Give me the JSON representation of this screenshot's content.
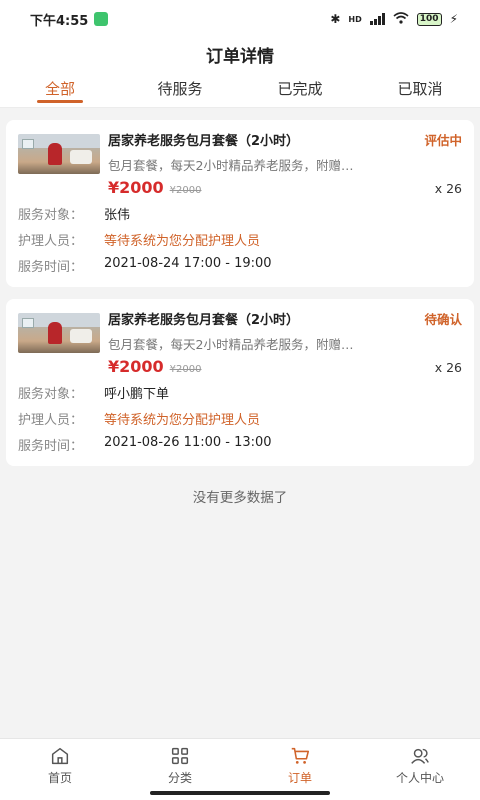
{
  "status_bar": {
    "time": "下午4:55",
    "network": "HD",
    "battery": "100"
  },
  "title": "订单详情",
  "tabs": [
    {
      "label": "全部",
      "active": true
    },
    {
      "label": "待服务",
      "active": false
    },
    {
      "label": "已完成",
      "active": false
    },
    {
      "label": "已取消",
      "active": false
    }
  ],
  "orders": [
    {
      "name": "居家养老服务包月套餐（2小时）",
      "status": "评估中",
      "desc": "包月套餐，每天2小时精品养老服务，附赠…",
      "price": "¥2000",
      "original_price": "¥2000",
      "qty": "x 26",
      "fields": [
        {
          "label": "服务对象：",
          "value": "张伟"
        },
        {
          "label": "护理人员：",
          "value": "等待系统为您分配护理人员"
        },
        {
          "label": "服务时间：",
          "value": "2021-08-24 17:00 - 19:00"
        }
      ]
    },
    {
      "name": "居家养老服务包月套餐（2小时）",
      "status": "待确认",
      "desc": "包月套餐，每天2小时精品养老服务，附赠…",
      "price": "¥2000",
      "original_price": "¥2000",
      "qty": "x 26",
      "fields": [
        {
          "label": "服务对象：",
          "value": "呼小鹏下单"
        },
        {
          "label": "护理人员：",
          "value": "等待系统为您分配护理人员"
        },
        {
          "label": "服务时间：",
          "value": "2021-08-26 11:00 - 13:00"
        }
      ]
    }
  ],
  "no_more": "没有更多数据了",
  "bottom_nav": [
    {
      "label": "首页",
      "icon": "home-icon",
      "active": false
    },
    {
      "label": "分类",
      "icon": "grid-icon",
      "active": false
    },
    {
      "label": "订单",
      "icon": "cart-icon",
      "active": true
    },
    {
      "label": "个人中心",
      "icon": "users-icon",
      "active": false
    }
  ],
  "colors": {
    "accent": "#d0632a",
    "price": "#d62b2b"
  }
}
